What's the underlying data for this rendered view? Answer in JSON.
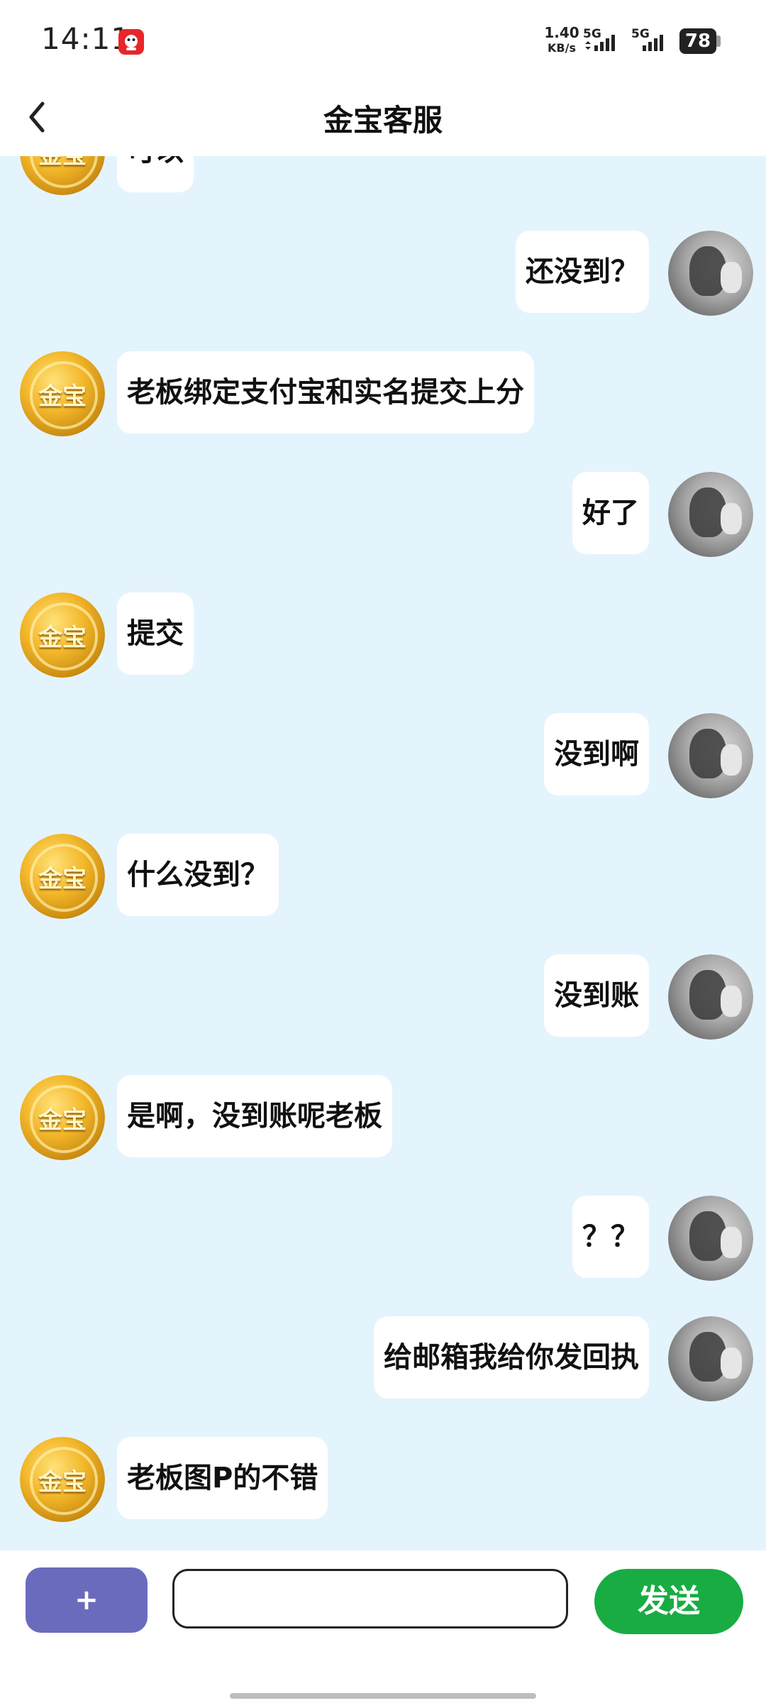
{
  "status_bar": {
    "time": "14:11",
    "net_speed_value": "1.40",
    "net_speed_unit": "KB/s",
    "signal1_label": "5G",
    "signal2_label": "5G",
    "battery_level": "78"
  },
  "header": {
    "title": "金宝客服"
  },
  "messages": [
    {
      "side": "left",
      "text": "可以",
      "avatar": "gold-coin-avatar"
    },
    {
      "side": "right",
      "text": "还没到？",
      "avatar": "user-avatar"
    },
    {
      "side": "left",
      "text": "老板绑定支付宝和实名提交上分",
      "avatar": "gold-coin-avatar"
    },
    {
      "side": "right",
      "text": "好了",
      "avatar": "user-avatar"
    },
    {
      "side": "left",
      "text": "提交",
      "avatar": "gold-coin-avatar"
    },
    {
      "side": "right",
      "text": "没到啊",
      "avatar": "user-avatar"
    },
    {
      "side": "left",
      "text": "什么没到？",
      "avatar": "gold-coin-avatar"
    },
    {
      "side": "right",
      "text": "没到账",
      "avatar": "user-avatar"
    },
    {
      "side": "left",
      "text": "是啊，没到账呢老板",
      "avatar": "gold-coin-avatar"
    },
    {
      "side": "right",
      "text": "？？",
      "avatar": "user-avatar"
    },
    {
      "side": "right",
      "text": "给邮箱我给你发回执",
      "avatar": "user-avatar"
    },
    {
      "side": "left",
      "text": "老板图P的不错",
      "avatar": "gold-coin-avatar"
    }
  ],
  "avatar_text": "金宝",
  "input_bar": {
    "plus_label": "+",
    "input_value": "",
    "input_placeholder": "",
    "send_label": "发送"
  },
  "colors": {
    "chat_background": "#e4f4fd",
    "plus_button": "#6b6bbd",
    "send_button": "#19ac43"
  }
}
